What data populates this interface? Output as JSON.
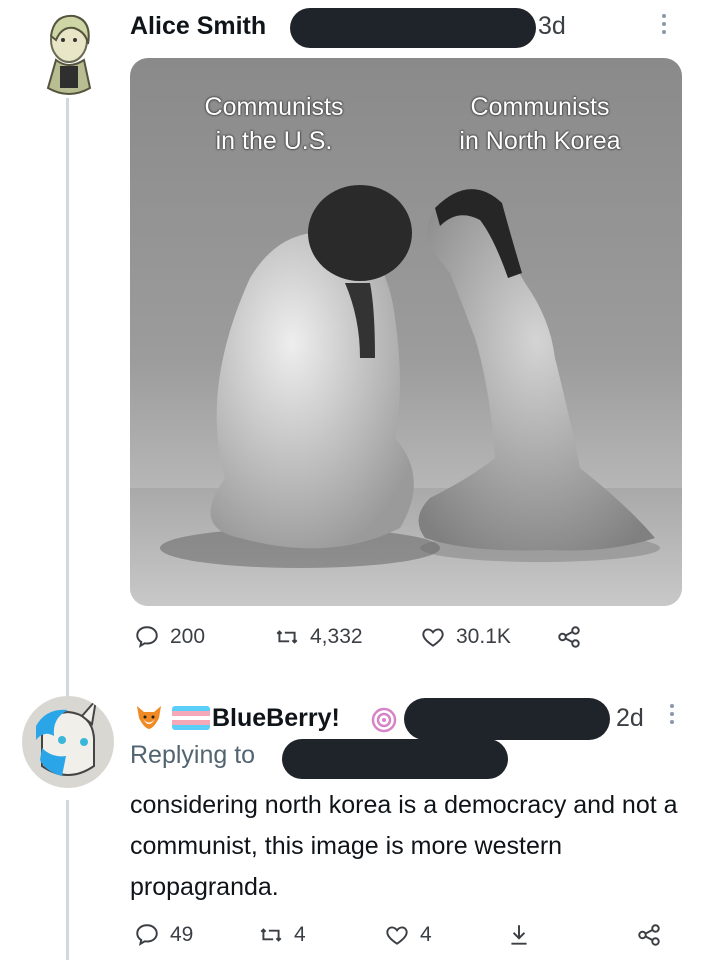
{
  "tweet": {
    "author_name": "Alice Smith",
    "time": "3d",
    "media": {
      "caption_left": "Communists\nin the U.S.",
      "caption_right": "Communists\nin North Korea",
      "caption_left_l1": "Communists",
      "caption_left_l2": "in the U.S.",
      "caption_right_l1": "Communists",
      "caption_right_l2": "in North Korea"
    },
    "actions": {
      "replies": "200",
      "retweets": "4,332",
      "likes": "30.1K"
    }
  },
  "reply": {
    "author_name": "BlueBerry!",
    "time": "2d",
    "replying_to_label": "Replying to",
    "text": "considering north korea is a democracy and not a communist, this image is more western propagranda.",
    "actions": {
      "replies": "49",
      "retweets": "4",
      "likes": "4"
    }
  },
  "icons": [
    "reply-icon",
    "retweet-icon",
    "like-icon",
    "share-icon",
    "download-icon",
    "more-icon",
    "fox-emoji-icon",
    "trans-flag-icon",
    "spiral-icon"
  ]
}
